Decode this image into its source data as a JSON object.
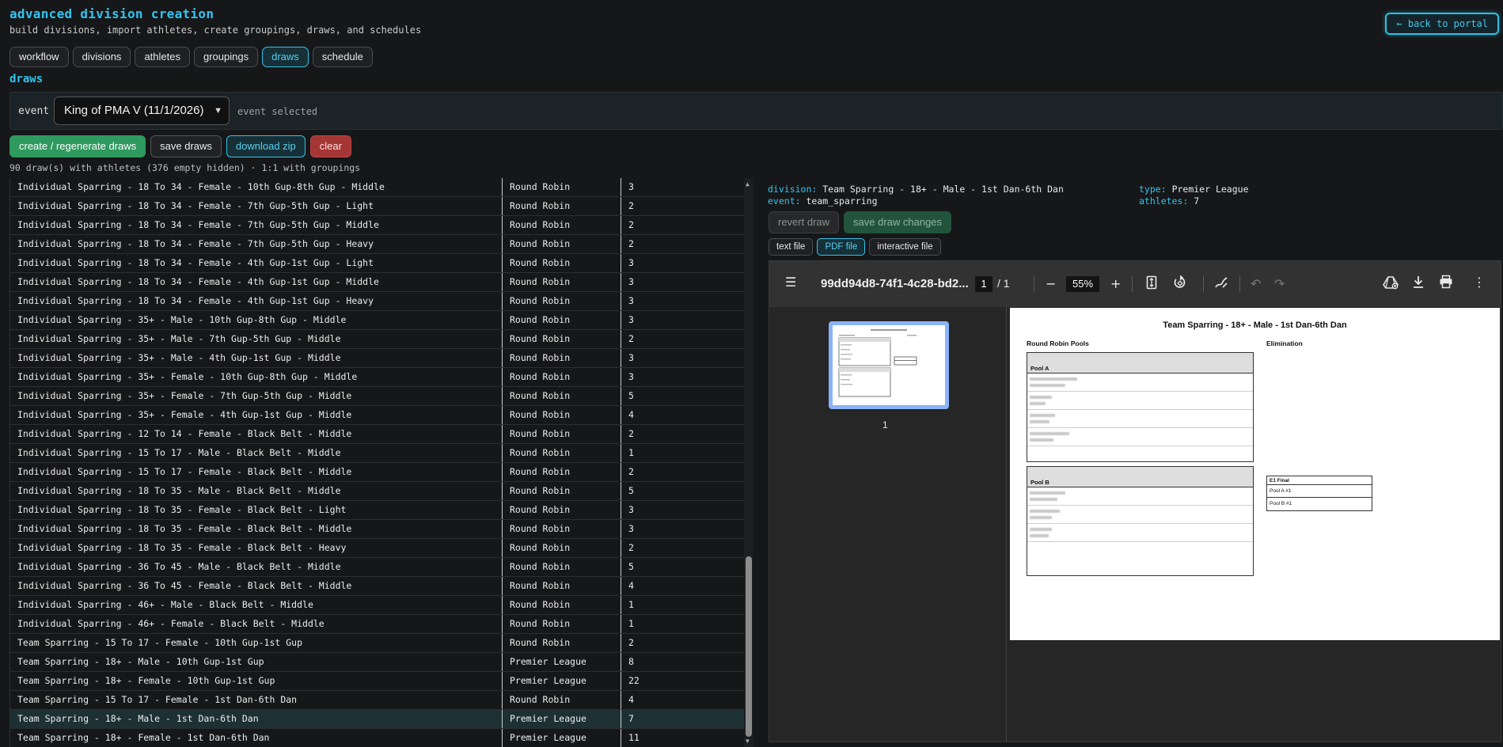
{
  "header": {
    "title": "advanced division creation",
    "subtitle": "build divisions, import athletes, create groupings, draws, and schedules",
    "back_label": "← back to portal"
  },
  "nav": {
    "tabs": [
      {
        "label": "workflow"
      },
      {
        "label": "divisions"
      },
      {
        "label": "athletes"
      },
      {
        "label": "groupings"
      },
      {
        "label": "draws",
        "active": true
      },
      {
        "label": "schedule"
      }
    ]
  },
  "section_title": "draws",
  "event": {
    "label": "event",
    "selected": "King of PMA V (11/1/2026)",
    "status": "event selected"
  },
  "actions": {
    "create": "create / regenerate draws",
    "save": "save draws",
    "download": "download zip",
    "clear": "clear"
  },
  "summary": "90 draw(s) with athletes (376 empty hidden) · 1:1 with groupings",
  "rows": [
    {
      "name": "Individual Sparring - 18 To 34 - Female - 10th Gup-8th Gup - Middle",
      "type": "Round Robin",
      "count": "3"
    },
    {
      "name": "Individual Sparring - 18 To 34 - Female - 7th Gup-5th Gup - Light",
      "type": "Round Robin",
      "count": "2"
    },
    {
      "name": "Individual Sparring - 18 To 34 - Female - 7th Gup-5th Gup - Middle",
      "type": "Round Robin",
      "count": "2"
    },
    {
      "name": "Individual Sparring - 18 To 34 - Female - 7th Gup-5th Gup - Heavy",
      "type": "Round Robin",
      "count": "2"
    },
    {
      "name": "Individual Sparring - 18 To 34 - Female - 4th Gup-1st Gup - Light",
      "type": "Round Robin",
      "count": "3"
    },
    {
      "name": "Individual Sparring - 18 To 34 - Female - 4th Gup-1st Gup - Middle",
      "type": "Round Robin",
      "count": "3"
    },
    {
      "name": "Individual Sparring - 18 To 34 - Female - 4th Gup-1st Gup - Heavy",
      "type": "Round Robin",
      "count": "3"
    },
    {
      "name": "Individual Sparring - 35+ - Male - 10th Gup-8th Gup - Middle",
      "type": "Round Robin",
      "count": "3"
    },
    {
      "name": "Individual Sparring - 35+ - Male - 7th Gup-5th Gup - Middle",
      "type": "Round Robin",
      "count": "2"
    },
    {
      "name": "Individual Sparring - 35+ - Male - 4th Gup-1st Gup - Middle",
      "type": "Round Robin",
      "count": "3"
    },
    {
      "name": "Individual Sparring - 35+ - Female - 10th Gup-8th Gup - Middle",
      "type": "Round Robin",
      "count": "3"
    },
    {
      "name": "Individual Sparring - 35+ - Female - 7th Gup-5th Gup - Middle",
      "type": "Round Robin",
      "count": "5"
    },
    {
      "name": "Individual Sparring - 35+ - Female - 4th Gup-1st Gup - Middle",
      "type": "Round Robin",
      "count": "4"
    },
    {
      "name": "Individual Sparring - 12 To 14 - Female - Black Belt - Middle",
      "type": "Round Robin",
      "count": "2"
    },
    {
      "name": "Individual Sparring - 15 To 17 - Male - Black Belt - Middle",
      "type": "Round Robin",
      "count": "1"
    },
    {
      "name": "Individual Sparring - 15 To 17 - Female - Black Belt - Middle",
      "type": "Round Robin",
      "count": "2"
    },
    {
      "name": "Individual Sparring - 18 To 35 - Male - Black Belt - Middle",
      "type": "Round Robin",
      "count": "5"
    },
    {
      "name": "Individual Sparring - 18 To 35 - Female - Black Belt - Light",
      "type": "Round Robin",
      "count": "3"
    },
    {
      "name": "Individual Sparring - 18 To 35 - Female - Black Belt - Middle",
      "type": "Round Robin",
      "count": "3"
    },
    {
      "name": "Individual Sparring - 18 To 35 - Female - Black Belt - Heavy",
      "type": "Round Robin",
      "count": "2"
    },
    {
      "name": "Individual Sparring - 36 To 45 - Male - Black Belt - Middle",
      "type": "Round Robin",
      "count": "5"
    },
    {
      "name": "Individual Sparring - 36 To 45 - Female - Black Belt - Middle",
      "type": "Round Robin",
      "count": "4"
    },
    {
      "name": "Individual Sparring - 46+ - Male - Black Belt - Middle",
      "type": "Round Robin",
      "count": "1"
    },
    {
      "name": "Individual Sparring - 46+ - Female - Black Belt - Middle",
      "type": "Round Robin",
      "count": "1"
    },
    {
      "name": "Team Sparring - 15 To 17 - Female - 10th Gup-1st Gup",
      "type": "Round Robin",
      "count": "2"
    },
    {
      "name": "Team Sparring - 18+ - Male - 10th Gup-1st Gup",
      "type": "Premier League",
      "count": "8"
    },
    {
      "name": "Team Sparring - 18+ - Female - 10th Gup-1st Gup",
      "type": "Premier League",
      "count": "22"
    },
    {
      "name": "Team Sparring - 15 To 17 - Female - 1st Dan-6th Dan",
      "type": "Round Robin",
      "count": "4"
    },
    {
      "name": "Team Sparring - 18+ - Male - 1st Dan-6th Dan",
      "type": "Premier League",
      "count": "7",
      "selected": true
    },
    {
      "name": "Team Sparring - 18+ - Female - 1st Dan-6th Dan",
      "type": "Premier League",
      "count": "11"
    }
  ],
  "detail": {
    "division_key": "division:",
    "division": "Team Sparring - 18+ - Male - 1st Dan-6th Dan",
    "event_key": "event:",
    "event": "team_sparring",
    "type_key": "type:",
    "type": "Premier League",
    "athletes_key": "athletes:",
    "athletes": "7",
    "revert": "revert draw",
    "save_changes": "save draw changes",
    "file_tabs": {
      "text": "text file",
      "pdf": "PDF file",
      "interactive": "interactive file"
    }
  },
  "viewer": {
    "filename": "99dd94d8-74f1-4c28-bd2...",
    "page": "1",
    "page_total": "/  1",
    "zoom": "55%",
    "thumb_label": "1",
    "doc": {
      "title": "Team Sparring - 18+ - Male - 1st Dan-6th Dan",
      "pools_heading": "Round Robin Pools",
      "elimination_heading": "Elimination",
      "pool_a": "Pool A",
      "pool_b": "Pool B",
      "final_title": "E1 Final",
      "final_slot1": "Pool A #1",
      "final_slot2": "Pool B #1"
    }
  },
  "icons": [
    "menu-icon",
    "minus-icon",
    "plus-icon",
    "fit-page-icon",
    "rotate-icon",
    "annotate-icon",
    "undo-icon",
    "redo-icon",
    "drive-icon",
    "download-icon",
    "print-icon",
    "more-icon"
  ]
}
